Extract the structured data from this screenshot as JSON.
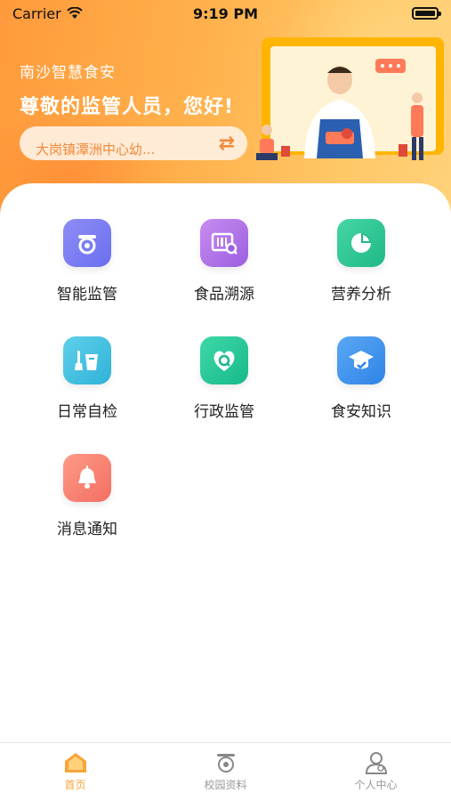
{
  "status_bar": {
    "carrier": "Carrier",
    "time": "9:19 PM"
  },
  "header": {
    "brand": "南沙智慧食安",
    "greeting": "尊敬的监管人员，您好!",
    "school": "大岗镇潭洲中心幼..."
  },
  "menu": [
    {
      "label": "智能监管",
      "icon": "camera-icon"
    },
    {
      "label": "食品溯源",
      "icon": "barcode-scan-icon"
    },
    {
      "label": "营养分析",
      "icon": "pie-chart-icon"
    },
    {
      "label": "日常自检",
      "icon": "cleaning-tools-icon"
    },
    {
      "label": "行政监管",
      "icon": "shield-heart-icon"
    },
    {
      "label": "食安知识",
      "icon": "graduation-cap-icon"
    },
    {
      "label": "消息通知",
      "icon": "bell-icon"
    }
  ],
  "tabbar": [
    {
      "label": "首页",
      "icon": "home-icon",
      "active": true
    },
    {
      "label": "校园资料",
      "icon": "camera-icon",
      "active": false
    },
    {
      "label": "个人中心",
      "icon": "user-icon",
      "active": false
    }
  ],
  "colors": {
    "accent": "#f7a53a",
    "header_gradient_start": "#ff9a3c",
    "header_gradient_end": "#ffd27a"
  }
}
